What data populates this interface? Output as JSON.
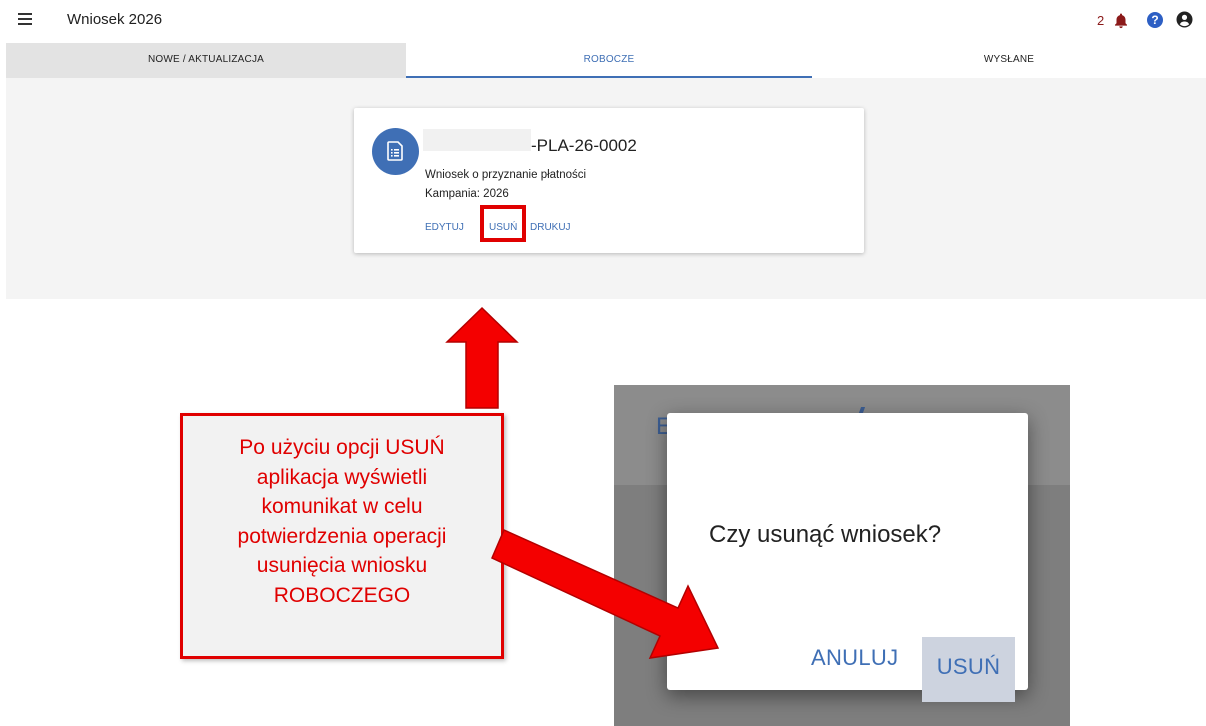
{
  "header": {
    "title": "Wniosek 2026",
    "notification_count": "2",
    "help_glyph": "?",
    "icons": {
      "menu": "menu-icon",
      "bell": "bell-icon",
      "help": "help-icon",
      "account": "account-icon"
    },
    "colors": {
      "accent": "#3f6fb5",
      "notification": "#8b1a1a"
    }
  },
  "tabs": [
    {
      "label": "NOWE / AKTUALIZACJA",
      "active": false
    },
    {
      "label": "ROBOCZE",
      "active": true
    },
    {
      "label": "WYSŁANE",
      "active": false
    }
  ],
  "card": {
    "icon": "document-icon",
    "number": "-PLA-26-0002",
    "subtitle": "Wniosek o przyznanie płatności",
    "campaign": "Kampania: 2026",
    "actions": {
      "edit": "EDYTUJ",
      "delete": "USUŃ",
      "print": "DRUKUJ"
    }
  },
  "callout": {
    "lines": [
      "Po użyciu opcji USUŃ",
      "aplikacja wyświetli",
      "komunikat w celu",
      "potwierdzenia operacji",
      "usunięcia wniosku",
      "ROBOCZEGO"
    ],
    "color": "#e00000"
  },
  "dialog": {
    "background_letter": "E",
    "question": "Czy usunąć wniosek?",
    "cancel_label": "ANULUJ",
    "confirm_label": "USUŃ"
  }
}
